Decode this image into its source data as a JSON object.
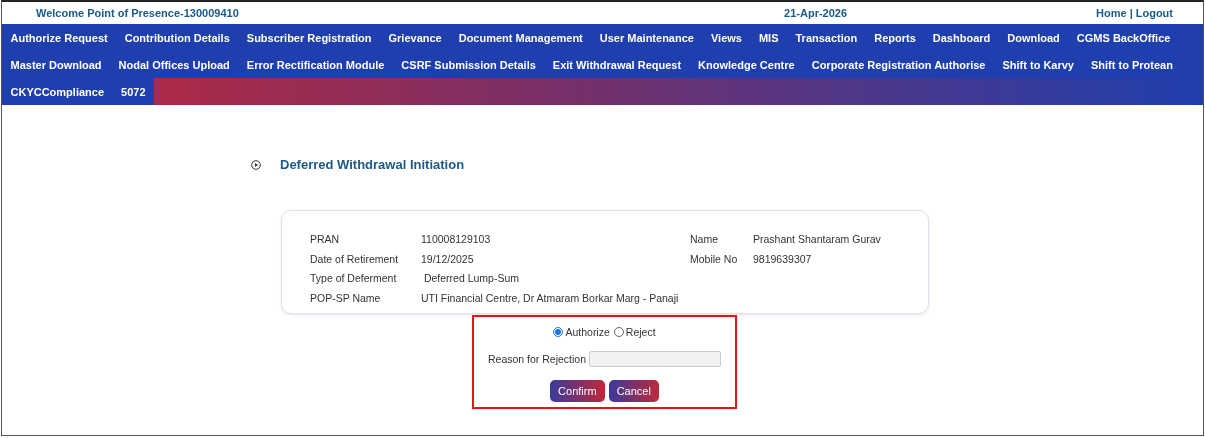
{
  "header": {
    "welcome": "Welcome Point of Presence-130009410",
    "date": "21-Apr-2026",
    "home_link": "Home",
    "separator": "|",
    "logout_link": "Logout"
  },
  "menu": {
    "rows": [
      {
        "items": [
          "Authorize Request",
          "Contribution Details",
          "Subscriber Registration",
          "Grievance",
          "Document Management",
          "User Maintenance",
          "Views",
          "MIS",
          "Transaction",
          "Reports",
          "Dashboard",
          "Download",
          "CGMS BackOffice"
        ]
      },
      {
        "items": [
          "Master Download",
          "Nodal Offices Upload",
          "Error Rectification Module",
          "CSRF Submission Details",
          "Exit Withdrawal Request",
          "Knowledge Centre",
          "Corporate Registration Authorise",
          "Shift to Karvy",
          "Shift to Protean"
        ]
      },
      {
        "items": [
          "CKYCCompliance",
          "5072"
        ]
      }
    ]
  },
  "page_title": "Deferred Withdrawal Initiation",
  "details": {
    "left": [
      {
        "label": "PRAN",
        "value": "110008129103"
      },
      {
        "label": "Date of Retirement",
        "value": "19/12/2025"
      },
      {
        "label": "Type of Deferment",
        "value": " Deferred Lump-Sum"
      },
      {
        "label": "POP-SP Name",
        "value": "UTI Financial Centre, Dr Atmaram Borkar Marg - Panaji"
      }
    ],
    "right": [
      {
        "label": "Name",
        "value": "Prashant Shantaram Gurav"
      },
      {
        "label": "Mobile No",
        "value": "9819639307"
      }
    ]
  },
  "decision": {
    "options": [
      {
        "label": "Authorize",
        "selected": true
      },
      {
        "label": "Reject",
        "selected": false
      }
    ],
    "reason_label": "Reason for Rejection",
    "buttons": [
      "Confirm",
      "Cancel"
    ]
  }
}
